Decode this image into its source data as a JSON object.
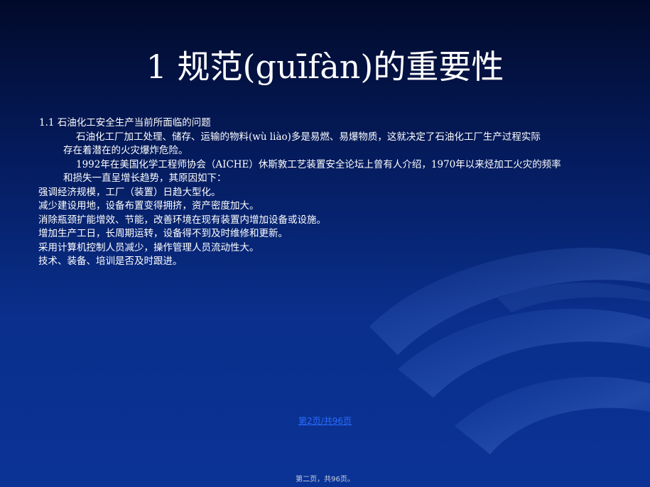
{
  "slide": {
    "title": "1   规范(guīfàn)的重要性",
    "section_heading": "1.1   石油化工安全生产当前所面临的问题",
    "paragraph1_line1": "石油化工厂加工处理、储存、运输的物料(wù liào)多是易燃、易爆物质，这就决定了石油化工厂生产过程实际",
    "paragraph1_line2": "存在着潜在的火灾爆炸危险。",
    "paragraph2_line1": "1992年在美国化学工程师协会（AICHE）休斯敦工艺装置安全论坛上曾有人介绍，1970年以来烃加工火灾的频率",
    "paragraph2_line2": "和损失一直呈增长趋势，其原因如下：",
    "reasons": [
      "强调经济规模，工厂（装置）日趋大型化。",
      "减少建设用地，设备布置变得拥挤，资产密度加大。",
      "消除瓶颈扩能增效、节能，改善环境在现有装置内增加设备或设施。",
      "增加生产工日，长周期运转，设备得不到及时维修和更新。",
      "采用计算机控制人员减少，操作管理人员流动性大。",
      "技术、装备、培训是否及时跟进。"
    ],
    "page_link": "第2页/共96页",
    "footer": "第二页，共96页。"
  },
  "colors": {
    "background_top": "#020a2a",
    "background_bottom": "#0b3396",
    "text": "#ffffff",
    "link": "#2a6cff"
  }
}
